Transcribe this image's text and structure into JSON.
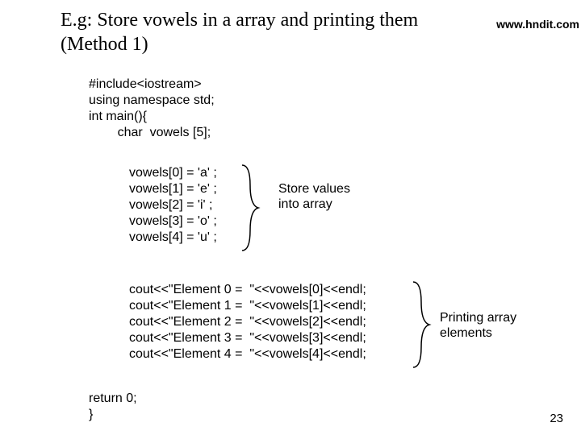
{
  "title_line1": "E.g: Store vowels in a array and printing them",
  "title_line2": "(Method 1)",
  "watermark": "www.hndit.com",
  "code": {
    "block1": "#include<iostream>\nusing namespace std;\nint main(){\n        char  vowels [5];",
    "block2": "vowels[0] = 'a' ;\nvowels[1] = 'e' ;\nvowels[2] = 'i' ;\nvowels[3] = 'o' ;\nvowels[4] = 'u' ;",
    "block3": "cout<<\"Element 0 =  \"<<vowels[0]<<endl;\ncout<<\"Element 1 =  \"<<vowels[1]<<endl;\ncout<<\"Element 2 =  \"<<vowels[2]<<endl;\ncout<<\"Element 3 =  \"<<vowels[3]<<endl;\ncout<<\"Element 4 =  \"<<vowels[4]<<endl;",
    "block4": "return 0;\n}"
  },
  "annotations": {
    "store": "Store values into array",
    "print": "Printing array elements"
  },
  "page_number": "23"
}
